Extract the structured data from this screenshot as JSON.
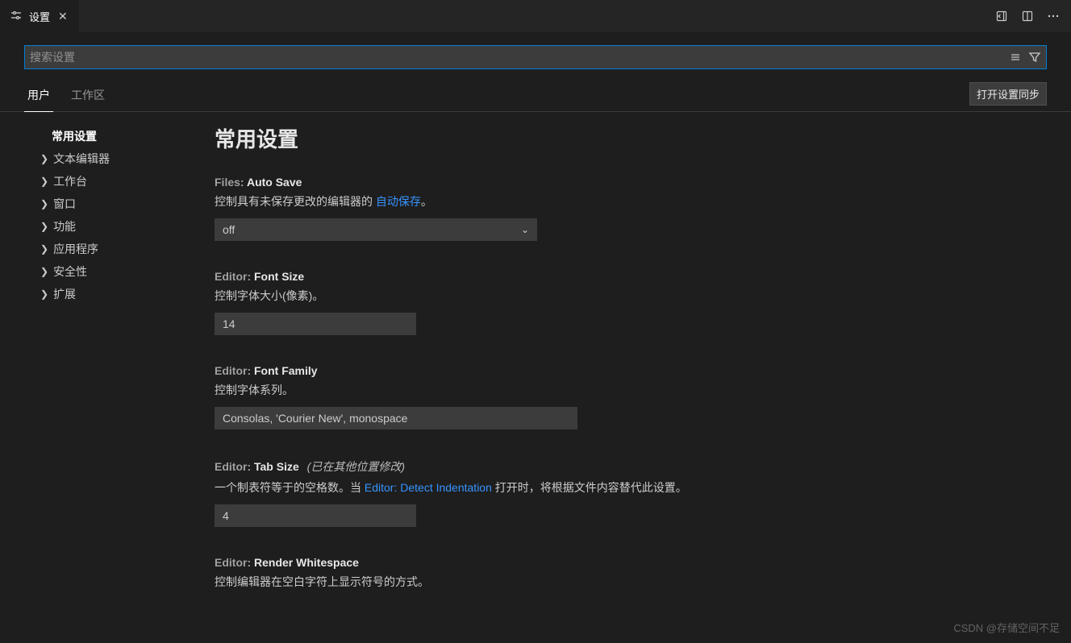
{
  "tab": {
    "label": "设置"
  },
  "search": {
    "placeholder": "搜索设置"
  },
  "scopes": {
    "user": "用户",
    "workspace": "工作区"
  },
  "sync_button": "打开设置同步",
  "toc": {
    "common": "常用设置",
    "items": [
      "文本编辑器",
      "工作台",
      "窗口",
      "功能",
      "应用程序",
      "安全性",
      "扩展"
    ]
  },
  "section_title": "常用设置",
  "settings": {
    "autosave": {
      "scope": "Files:",
      "name": "Auto Save",
      "desc_before": "控制具有未保存更改的编辑器的 ",
      "desc_link": "自动保存",
      "desc_after": "。",
      "value": "off"
    },
    "fontsize": {
      "scope": "Editor:",
      "name": "Font Size",
      "desc": "控制字体大小(像素)。",
      "value": "14"
    },
    "fontfamily": {
      "scope": "Editor:",
      "name": "Font Family",
      "desc": "控制字体系列。",
      "value": "Consolas, 'Courier New', monospace"
    },
    "tabsize": {
      "scope": "Editor:",
      "name": "Tab Size",
      "modified": "(已在其他位置修改)",
      "desc_before": "一个制表符等于的空格数。当 ",
      "desc_link": "Editor: Detect Indentation",
      "desc_after": " 打开时，将根据文件内容替代此设置。",
      "value": "4"
    },
    "whitespace": {
      "scope": "Editor:",
      "name": "Render Whitespace",
      "desc": "控制编辑器在空白字符上显示符号的方式。"
    }
  },
  "watermark": "CSDN @存储空间不足"
}
